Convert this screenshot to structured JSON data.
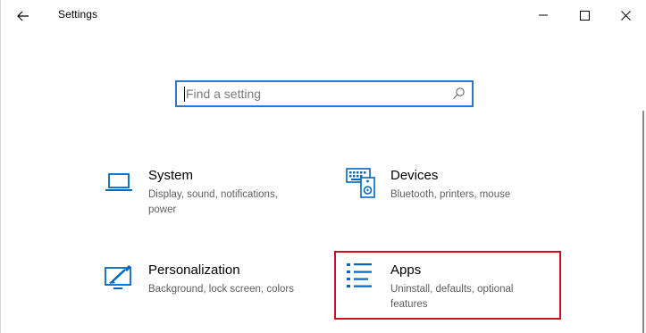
{
  "window": {
    "title": "Settings",
    "back_icon": "back-arrow-icon",
    "controls": [
      "minimize-icon",
      "maximize-icon",
      "close-icon"
    ]
  },
  "search": {
    "placeholder": "Find a setting",
    "value": "",
    "icon": "search-icon"
  },
  "categories": [
    {
      "icon": "laptop-icon",
      "title": "System",
      "description": "Display, sound, notifications, power"
    },
    {
      "icon": "keyboard-speaker-icon",
      "title": "Devices",
      "description": "Bluetooth, printers, mouse"
    },
    {
      "icon": "paint-monitor-icon",
      "title": "Personalization",
      "description": "Background, lock screen, colors"
    },
    {
      "icon": "apps-list-icon",
      "title": "Apps",
      "description": "Uninstall, defaults, optional features"
    }
  ],
  "colors": {
    "accent": "#0067c0",
    "search_border": "#2b79c6",
    "highlight": "#c8101e",
    "description_text": "#5e5e5e"
  }
}
